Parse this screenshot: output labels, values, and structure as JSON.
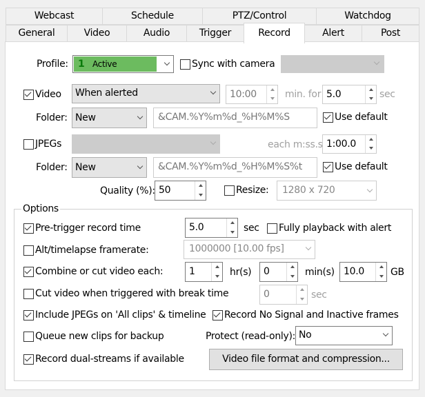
{
  "tabs_row1": [
    "Webcast",
    "Schedule",
    "PTZ/Control",
    "Watchdog"
  ],
  "tabs_row2": [
    "General",
    "Video",
    "Audio",
    "Trigger",
    "Record",
    "Alert",
    "Post"
  ],
  "selected_tab": "Record",
  "profile": {
    "label": "Profile:",
    "number": "1",
    "value": "Active",
    "color": "#6cbb5f",
    "sync_label": "Sync with camera",
    "sync_checked": false,
    "sync_combo": ""
  },
  "video": {
    "label": "Video",
    "checked": true,
    "mode": "When alerted",
    "time": "10:00",
    "min_for": "min. for",
    "duration": "5.0",
    "sec": "sec",
    "folder_label": "Folder:",
    "folder": "New",
    "filename": "&CAM.%Y%m%d_%H%M%S",
    "use_default": "Use default",
    "use_default_checked": true
  },
  "jpegs": {
    "label": "JPEGs",
    "checked": false,
    "mode": "",
    "each_label": "each m:ss.s",
    "interval": "1:00.0",
    "folder_label": "Folder:",
    "folder": "New",
    "filename": "&CAM.%Y%m%d_%H%M%S%t",
    "use_default": "Use default",
    "use_default_checked": true,
    "quality_label": "Quality (%):",
    "quality": "50",
    "resize_label": "Resize:",
    "resize_checked": false,
    "resize": "1280 x 720"
  },
  "options": {
    "title": "Options",
    "pretrigger": {
      "label": "Pre-trigger record time",
      "checked": true,
      "value": "5.0",
      "unit": "sec"
    },
    "full_playback": {
      "label": "Fully playback with alert",
      "checked": false
    },
    "timelapse": {
      "label": "Alt/timelapse framerate:",
      "checked": false,
      "value": "1000000 [10.00 fps]"
    },
    "combine": {
      "label": "Combine or cut video each:",
      "checked": true,
      "hours": "1",
      "hours_unit": "hr(s)",
      "mins": "0",
      "mins_unit": "min(s)",
      "gb": "10.0",
      "gb_unit": "GB"
    },
    "cut_break": {
      "label": "Cut video when triggered with break time",
      "checked": false,
      "value": "0",
      "unit": "sec"
    },
    "include_jpegs": {
      "label": "Include JPEGs on 'All clips' & timeline",
      "checked": true
    },
    "record_nosignal": {
      "label": "Record No Signal and Inactive frames",
      "checked": true
    },
    "queue_backup": {
      "label": "Queue new clips for backup",
      "checked": false
    },
    "protect": {
      "label": "Protect (read-only):",
      "value": "No"
    },
    "dual_streams": {
      "label": "Record dual-streams if available",
      "checked": true
    },
    "format_button": "Video file format and compression..."
  }
}
